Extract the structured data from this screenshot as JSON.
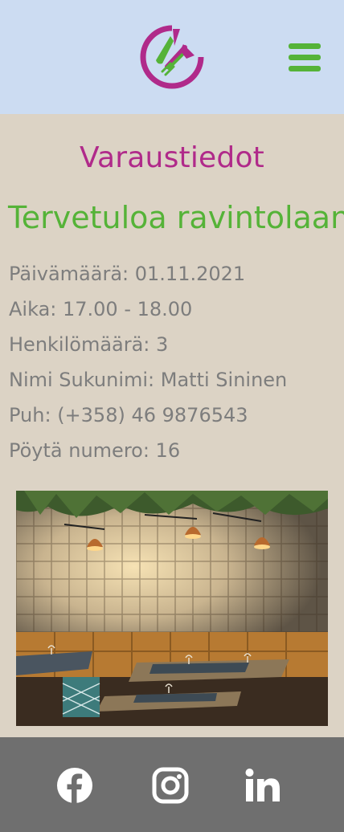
{
  "header": {
    "logo_icon": "restaurant-plate-cutlery-logo",
    "menu_icon": "hamburger-menu-icon",
    "brand_colors": {
      "magenta": "#b02a8a",
      "green": "#55b338",
      "header_bg": "#ccdcf2"
    }
  },
  "main": {
    "title": "Varaustiedot",
    "welcome": "Tervetuloa ravintolaan",
    "details": {
      "date": "Päivämäärä: 01.11.2021",
      "time": "Aika: 17.00 - 18.00",
      "people": "Henkilömäärä: 3",
      "name": "Nimi Sukunimi: Matti Sininen",
      "phone": "Puh: (+358) 46 9876543",
      "table": "Pöytä numero: 16"
    },
    "photo_subject": "restaurant-interior-photo"
  },
  "footer": {
    "icons": [
      "facebook-icon",
      "instagram-icon",
      "linkedin-icon"
    ]
  }
}
